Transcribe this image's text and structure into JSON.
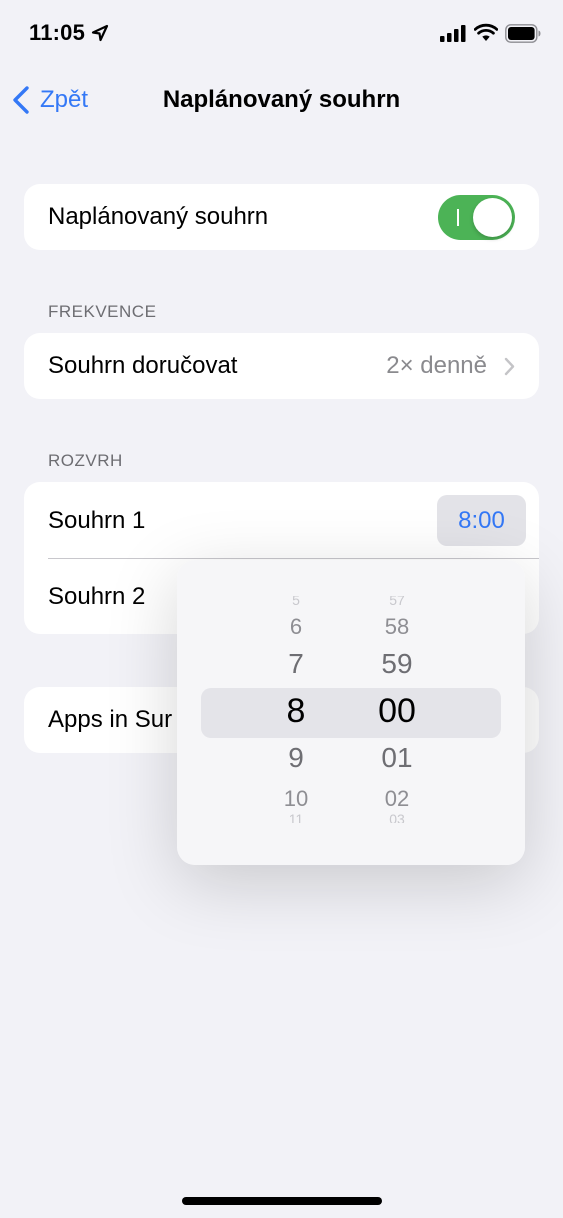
{
  "status_bar": {
    "time": "11:05"
  },
  "nav": {
    "back_label": "Zpět",
    "title": "Naplánovaný souhrn"
  },
  "toggle_row": {
    "label": "Naplánovaný souhrn",
    "on": true
  },
  "frequency": {
    "header": "FREKVENCE",
    "label": "Souhrn doručovat",
    "value": "2× denně"
  },
  "schedule": {
    "header": "ROZVRH",
    "items": [
      {
        "label": "Souhrn 1",
        "time": "8:00"
      },
      {
        "label": "Souhrn 2"
      }
    ]
  },
  "apps_row": {
    "label": "Apps in Sur"
  },
  "picker": {
    "hours": [
      "5",
      "6",
      "7",
      "8",
      "9",
      "10",
      "11"
    ],
    "minutes": [
      "57",
      "58",
      "59",
      "00",
      "01",
      "02",
      "03"
    ],
    "selected_hour": "8",
    "selected_minute": "00"
  },
  "colors": {
    "accent": "#3478f6",
    "toggle_on": "#4cb356",
    "background": "#f2f2f7"
  }
}
